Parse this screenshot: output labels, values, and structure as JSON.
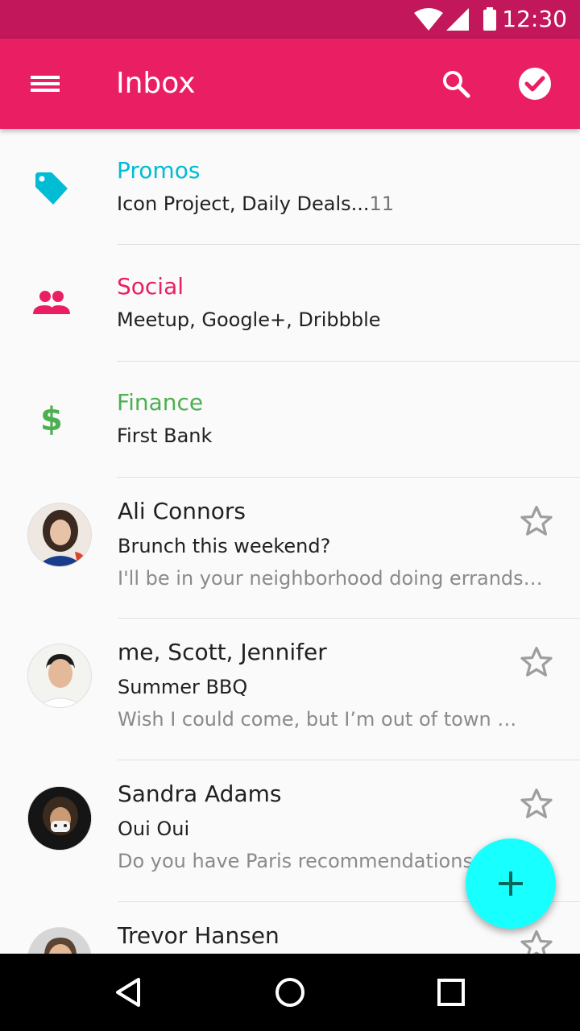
{
  "status_bar": {
    "time": "12:30"
  },
  "app_bar": {
    "title": "Inbox"
  },
  "categories": [
    {
      "title": "Promos",
      "subtitle": "Icon Project, Daily Deals...",
      "count": "11",
      "color": "#00BCD4",
      "icon": "tag-icon"
    },
    {
      "title": "Social",
      "subtitle": "Meetup, Google+, Dribbble",
      "count": "",
      "color": "#E91E63",
      "icon": "people-icon"
    },
    {
      "title": "Finance",
      "subtitle": "First Bank",
      "count": "",
      "color": "#4CAF50",
      "icon": "dollar-icon"
    }
  ],
  "emails": [
    {
      "sender": "Ali Connors",
      "subject": "Brunch this weekend?",
      "preview": "I'll be in your neighborhood doing errands…"
    },
    {
      "sender": "me, Scott, Jennifer",
      "subject": "Summer BBQ",
      "preview": "Wish I could come, but I’m out of town …"
    },
    {
      "sender": "Sandra Adams",
      "subject": "Oui Oui",
      "preview": "Do you have Paris recommendations"
    },
    {
      "sender": "Trevor Hansen",
      "subject": "",
      "preview": ""
    }
  ],
  "fab": {
    "icon": "plus-icon",
    "color": "#18FFFF"
  },
  "colors": {
    "status_bar": "#C2185B",
    "app_bar": "#E91E63",
    "background": "#FAFAFA"
  }
}
